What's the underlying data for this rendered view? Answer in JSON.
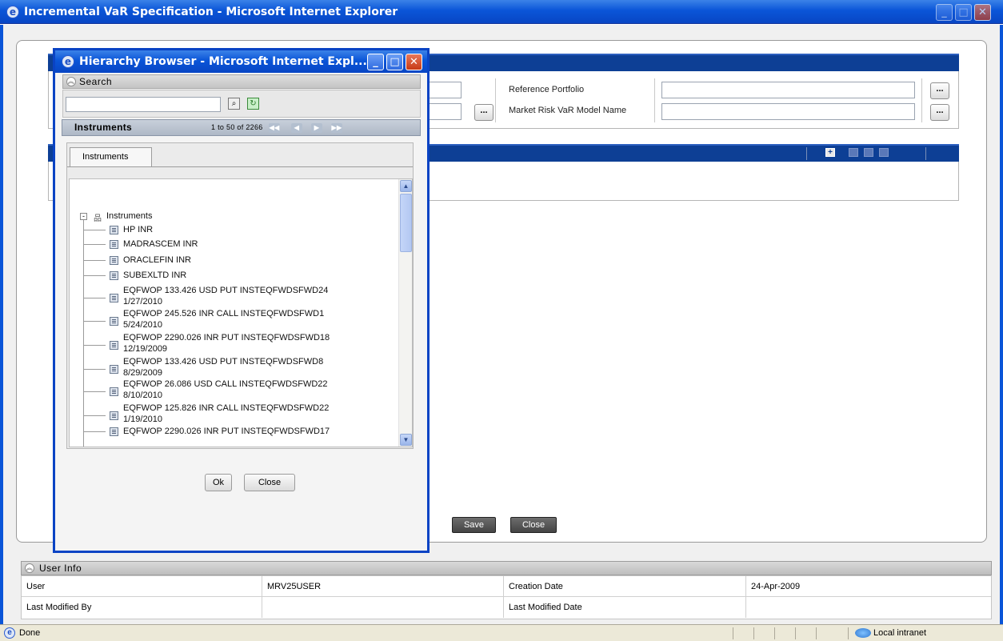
{
  "main_window": {
    "title": "Incremental VaR Specification - Microsoft Internet Explorer"
  },
  "form": {
    "reference_portfolio_label": "Reference Portfolio",
    "market_risk_label": "Market Risk VaR Model Name",
    "ellipsis": "..."
  },
  "buttons": {
    "save": "Save",
    "close": "Close"
  },
  "user_info": {
    "header": "User Info",
    "user_label": "User",
    "user_value": "MRV25USER",
    "creation_date_label": "Creation Date",
    "creation_date_value": "24-Apr-2009",
    "last_modified_by_label": "Last Modified By",
    "last_modified_date_label": "Last Modified Date"
  },
  "status_bar": {
    "text": "Done",
    "zone": "Local intranet"
  },
  "popup": {
    "title": "Hierarchy Browser - Microsoft Internet Expl...",
    "search_header": "Search",
    "search_value": "",
    "instruments_header": "Instruments",
    "pager": "1 to 50 of 2266",
    "tab_label": "Instruments",
    "tree_root": "Instruments",
    "tree_items": [
      {
        "line1": "HP INR",
        "line2": ""
      },
      {
        "line1": "MADRASCEM INR",
        "line2": ""
      },
      {
        "line1": "ORACLEFIN INR",
        "line2": ""
      },
      {
        "line1": "SUBEXLTD INR",
        "line2": ""
      },
      {
        "line1": "EQFWOP 133.426 USD PUT INSTEQFWDSFWD24",
        "line2": "1/27/2010"
      },
      {
        "line1": "EQFWOP 245.526 INR CALL INSTEQFWDSFWD1",
        "line2": "5/24/2010"
      },
      {
        "line1": "EQFWOP 2290.026 INR PUT INSTEQFWDSFWD18",
        "line2": "12/19/2009"
      },
      {
        "line1": "EQFWOP 133.426 USD PUT INSTEQFWDSFWD8",
        "line2": "8/29/2009"
      },
      {
        "line1": "EQFWOP 26.086 USD CALL INSTEQFWDSFWD22",
        "line2": "8/10/2010"
      },
      {
        "line1": "EQFWOP 125.826 INR CALL INSTEQFWDSFWD22",
        "line2": "1/19/2010"
      },
      {
        "line1": "EQFWOP 2290.026 INR PUT INSTEQFWDSFWD17",
        "line2": ""
      }
    ],
    "ok_button": "Ok",
    "close_button": "Close"
  }
}
